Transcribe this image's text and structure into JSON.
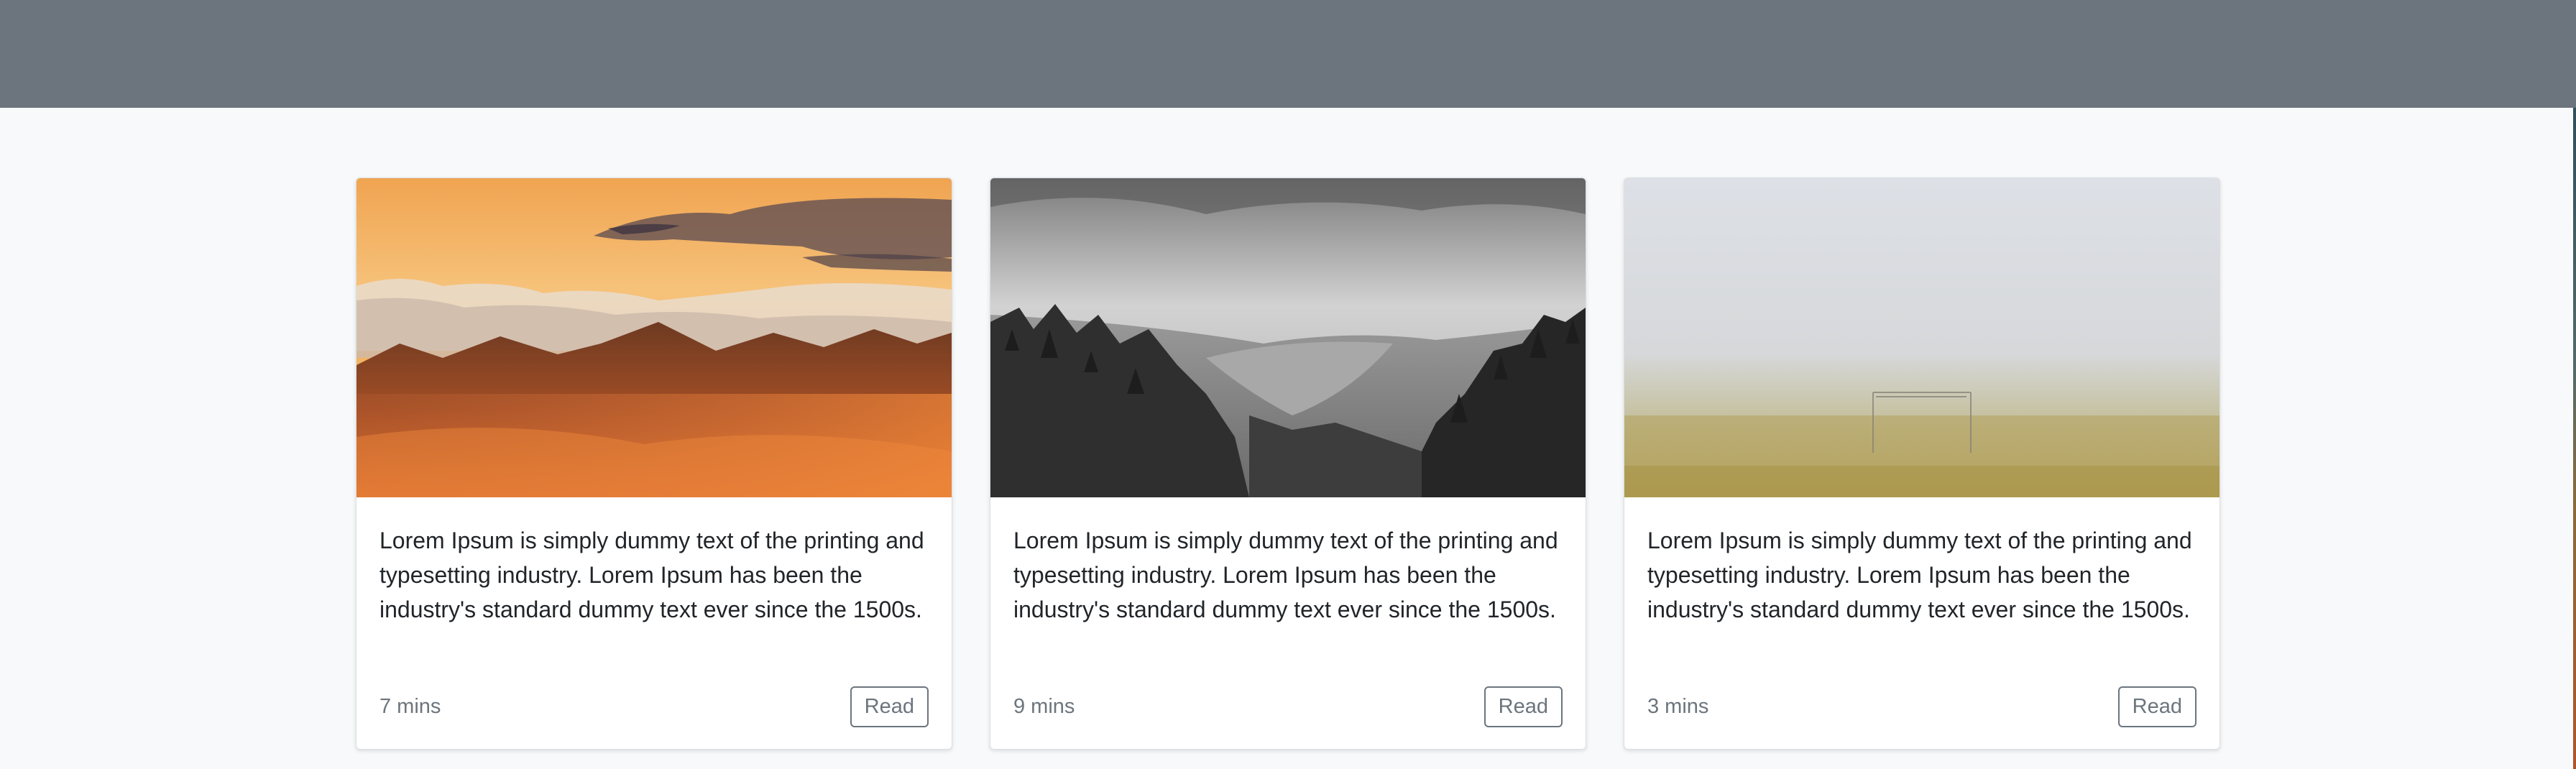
{
  "cards": [
    {
      "image": "mountain-sunset",
      "text": "Lorem Ipsum is simply dummy text of the printing and typesetting industry. Lorem Ipsum has been the industry's standard dummy text ever since the 1500s.",
      "duration": "7 mins",
      "button": "Read"
    },
    {
      "image": "forest-valley-bw",
      "text": "Lorem Ipsum is simply dummy text of the printing and typesetting industry. Lorem Ipsum has been the industry's standard dummy text ever since the 1500s.",
      "duration": "9 mins",
      "button": "Read"
    },
    {
      "image": "foggy-field",
      "text": "Lorem Ipsum is simply dummy text of the printing and typesetting industry. Lorem Ipsum has been the industry's standard dummy text ever since the 1500s.",
      "duration": "3 mins",
      "button": "Read"
    }
  ],
  "colors": {
    "header": "#6c757d",
    "page_background": "#f8f9fa",
    "muted_text": "#6c757d"
  }
}
